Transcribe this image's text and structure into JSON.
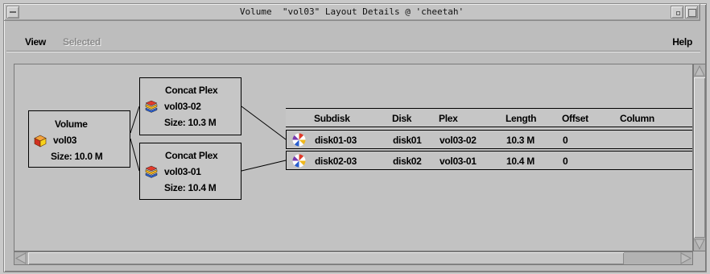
{
  "window": {
    "title": "Volume  \"vol03\" Layout Details @ 'cheetah'"
  },
  "menu": {
    "view": "View",
    "selected": "Selected",
    "help": "Help"
  },
  "volume": {
    "heading": "Volume",
    "name": "vol03",
    "size": "Size: 10.0 M",
    "icon": "volume-cube-icon",
    "icon_colors": {
      "top": "#f2a23c",
      "left": "#d03020",
      "right": "#f7d21c"
    }
  },
  "plexes": [
    {
      "heading": "Concat Plex",
      "name": "vol03-02",
      "size": "Size: 10.3 M",
      "icon": "plex-stack-icon"
    },
    {
      "heading": "Concat Plex",
      "name": "vol03-01",
      "size": "Size: 10.4 M",
      "icon": "plex-stack-icon"
    }
  ],
  "plex_icon_colors": [
    "#e33a2a",
    "#f2b21c",
    "#2b5fd1"
  ],
  "subdisk_table": {
    "columns": [
      "Subdisk",
      "Disk",
      "Plex",
      "Length",
      "Offset",
      "Column"
    ],
    "rows": [
      {
        "subdisk": "disk01-03",
        "disk": "disk01",
        "plex": "vol03-02",
        "length": "10.3 M",
        "offset": "0",
        "column": ""
      },
      {
        "subdisk": "disk02-03",
        "disk": "disk02",
        "plex": "vol03-01",
        "length": "10.4 M",
        "offset": "0",
        "column": ""
      }
    ],
    "row_icon": "subdisk-pinwheel-icon",
    "row_icon_colors": [
      "#e03a2a",
      "#f0b81c",
      "#2a5fd0",
      "#7a3ab0"
    ]
  }
}
